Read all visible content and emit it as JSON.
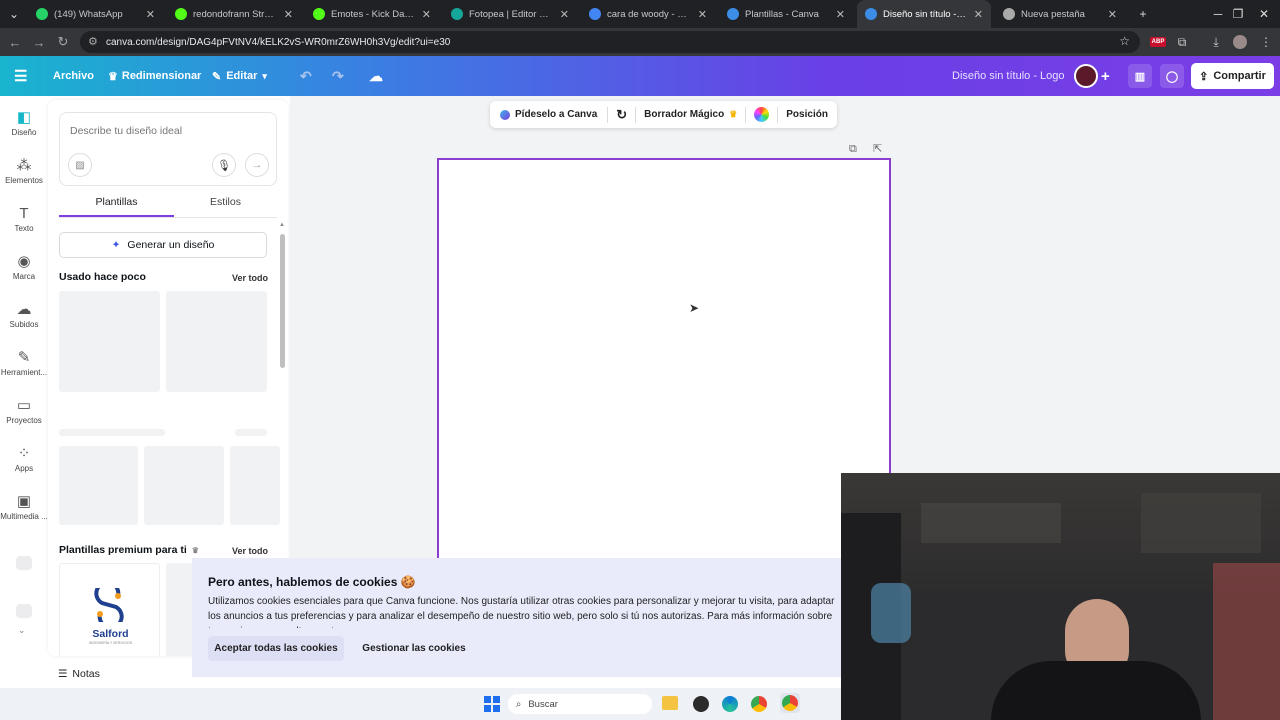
{
  "browser": {
    "tabs": [
      {
        "label": "(149) WhatsApp",
        "color": "#25d366"
      },
      {
        "label": "redondofrann Stream - W",
        "color": "#53fc18"
      },
      {
        "label": "Emotes - Kick Dashboard",
        "color": "#53fc18"
      },
      {
        "label": "Fotopea | Editor de fotos",
        "color": "#15a69a"
      },
      {
        "label": "cara de woody - Buscar c",
        "color": "#4285f4"
      },
      {
        "label": "Plantillas - Canva",
        "color": "#3b8de6"
      },
      {
        "label": "Diseño sin título - Logo",
        "color": "#3b8de6"
      },
      {
        "label": "Nueva pestaña",
        "color": "#aaaaaa"
      }
    ],
    "new_tab": "+",
    "url": "canva.com/design/DAG4pFVtNV4/kELK2vS-WR0mrZ6WH0h3Vg/edit?ui=e30",
    "ext_badge": "ABP"
  },
  "topbar": {
    "archivo": "Archivo",
    "redimensionar": "Redimensionar",
    "editar": "Editar",
    "design_title": "Diseño sin título - Logo",
    "share": "Compartir"
  },
  "rail": [
    {
      "label": "Diseño",
      "icon": "design-icon",
      "glyph": "◧"
    },
    {
      "label": "Elementos",
      "icon": "elements-icon",
      "glyph": "⁂"
    },
    {
      "label": "Texto",
      "icon": "text-icon",
      "glyph": "T"
    },
    {
      "label": "Marca",
      "icon": "brand-icon",
      "glyph": "◉"
    },
    {
      "label": "Subidos",
      "icon": "upload-icon",
      "glyph": "☁"
    },
    {
      "label": "Herramient...",
      "icon": "tools-icon",
      "glyph": "✎"
    },
    {
      "label": "Proyectos",
      "icon": "folder-icon",
      "glyph": "▭"
    },
    {
      "label": "Apps",
      "icon": "apps-icon",
      "glyph": "⁘"
    },
    {
      "label": "Multimedia ...",
      "icon": "media-icon",
      "glyph": "▣"
    }
  ],
  "panel": {
    "prompt_placeholder": "Describe tu diseño ideal",
    "tabs": [
      "Plantillas",
      "Estilos"
    ],
    "generate": "Generar un diseño",
    "recent_title": "Usado hace poco",
    "see_all": "Ver todo",
    "premium_title": "Plantillas premium para ti",
    "premium_see_all": "Ver todo",
    "template_brand": "Salford",
    "template_sub": "INGENIERÍA Y SERVICIOS"
  },
  "ctxbar": {
    "ask": "Pídeselo a Canva",
    "eraser": "Borrador Mágico",
    "position": "Posición"
  },
  "cookie": {
    "title": "Pero antes, hablemos de cookies 🍪",
    "body": "Utilizamos cookies esenciales para que Canva funcione. Nos gustaría utilizar otras cookies para personalizar y mejorar tu visita, para adaptar los anuncios a tus preferencias y para analizar el desempeño de nuestro sitio web, pero solo si tú nos autorizas. Para más información sobre tus opciones, consulta nuestra",
    "accept": "Aceptar todas las cookies",
    "manage": "Gestionar las cookies"
  },
  "notes": "Notas",
  "taskbar": {
    "search_placeholder": "Buscar"
  }
}
